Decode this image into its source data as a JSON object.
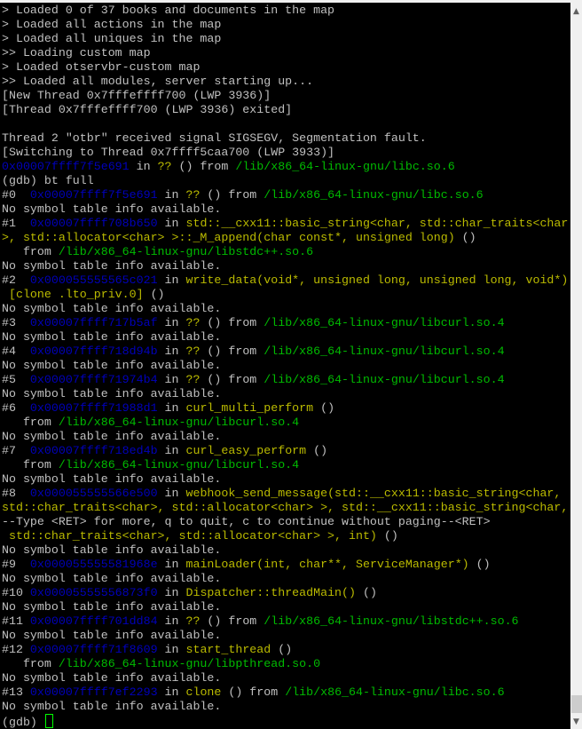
{
  "colors": {
    "default": "#c0c0c0",
    "address": "#0000bb",
    "function": "#bbbb00",
    "path": "#00bb00",
    "cursor": "#00ff00"
  },
  "lines": [
    [
      [
        "d",
        "> Loaded 0 of 37 books and documents in the map"
      ]
    ],
    [
      [
        "d",
        "> Loaded all actions in the map"
      ]
    ],
    [
      [
        "d",
        "> Loaded all uniques in the map"
      ]
    ],
    [
      [
        "d",
        ">> Loading custom map"
      ]
    ],
    [
      [
        "d",
        "> Loaded otservbr-custom map"
      ]
    ],
    [
      [
        "d",
        ">> Loaded all modules, server starting up..."
      ]
    ],
    [
      [
        "d",
        "[New Thread 0x7fffeffff700 (LWP 3936)]"
      ]
    ],
    [
      [
        "d",
        "[Thread 0x7fffeffff700 (LWP 3936) exited]"
      ]
    ],
    [],
    [
      [
        "d",
        "Thread 2 \"otbr\" received signal SIGSEGV, Segmentation fault."
      ]
    ],
    [
      [
        "d",
        "[Switching to Thread 0x7ffff5caa700 (LWP 3933)]"
      ]
    ],
    [
      [
        "a",
        "0x00007ffff7f5e691"
      ],
      [
        "d",
        " in "
      ],
      [
        "f",
        "??"
      ],
      [
        "d",
        " () from "
      ],
      [
        "p",
        "/lib/x86_64-linux-gnu/libc.so.6"
      ]
    ],
    [
      [
        "d",
        "(gdb) bt full"
      ]
    ],
    [
      [
        "d",
        "#0  "
      ],
      [
        "a",
        "0x00007ffff7f5e691"
      ],
      [
        "d",
        " in "
      ],
      [
        "f",
        "??"
      ],
      [
        "d",
        " () from "
      ],
      [
        "p",
        "/lib/x86_64-linux-gnu/libc.so.6"
      ]
    ],
    [
      [
        "d",
        "No symbol table info available."
      ]
    ],
    [
      [
        "d",
        "#1  "
      ],
      [
        "a",
        "0x00007ffff708b650"
      ],
      [
        "d",
        " in "
      ],
      [
        "f",
        "std::__cxx11::basic_string<char, std::char_traits<char"
      ]
    ],
    [
      [
        "f",
        ">, std::allocator<char> >::_M_append(char const*, unsigned long)"
      ],
      [
        "d",
        " ()"
      ]
    ],
    [
      [
        "d",
        "   from "
      ],
      [
        "p",
        "/lib/x86_64-linux-gnu/libstdc++.so.6"
      ]
    ],
    [
      [
        "d",
        "No symbol table info available."
      ]
    ],
    [
      [
        "d",
        "#2  "
      ],
      [
        "a",
        "0x000055555565c021"
      ],
      [
        "d",
        " in "
      ],
      [
        "f",
        "write_data(void*, unsigned long, unsigned long, void*)"
      ]
    ],
    [
      [
        "f",
        " [clone .lto_priv.0]"
      ],
      [
        "d",
        " ()"
      ]
    ],
    [
      [
        "d",
        "No symbol table info available."
      ]
    ],
    [
      [
        "d",
        "#3  "
      ],
      [
        "a",
        "0x00007ffff717b5af"
      ],
      [
        "d",
        " in "
      ],
      [
        "f",
        "??"
      ],
      [
        "d",
        " () from "
      ],
      [
        "p",
        "/lib/x86_64-linux-gnu/libcurl.so.4"
      ]
    ],
    [
      [
        "d",
        "No symbol table info available."
      ]
    ],
    [
      [
        "d",
        "#4  "
      ],
      [
        "a",
        "0x00007ffff718d94b"
      ],
      [
        "d",
        " in "
      ],
      [
        "f",
        "??"
      ],
      [
        "d",
        " () from "
      ],
      [
        "p",
        "/lib/x86_64-linux-gnu/libcurl.so.4"
      ]
    ],
    [
      [
        "d",
        "No symbol table info available."
      ]
    ],
    [
      [
        "d",
        "#5  "
      ],
      [
        "a",
        "0x00007ffff71974b4"
      ],
      [
        "d",
        " in "
      ],
      [
        "f",
        "??"
      ],
      [
        "d",
        " () from "
      ],
      [
        "p",
        "/lib/x86_64-linux-gnu/libcurl.so.4"
      ]
    ],
    [
      [
        "d",
        "No symbol table info available."
      ]
    ],
    [
      [
        "d",
        "#6  "
      ],
      [
        "a",
        "0x00007ffff71988d1"
      ],
      [
        "d",
        " in "
      ],
      [
        "f",
        "curl_multi_perform"
      ],
      [
        "d",
        " ()"
      ]
    ],
    [
      [
        "d",
        "   from "
      ],
      [
        "p",
        "/lib/x86_64-linux-gnu/libcurl.so.4"
      ]
    ],
    [
      [
        "d",
        "No symbol table info available."
      ]
    ],
    [
      [
        "d",
        "#7  "
      ],
      [
        "a",
        "0x00007ffff718ed4b"
      ],
      [
        "d",
        " in "
      ],
      [
        "f",
        "curl_easy_perform"
      ],
      [
        "d",
        " ()"
      ]
    ],
    [
      [
        "d",
        "   from "
      ],
      [
        "p",
        "/lib/x86_64-linux-gnu/libcurl.so.4"
      ]
    ],
    [
      [
        "d",
        "No symbol table info available."
      ]
    ],
    [
      [
        "d",
        "#8  "
      ],
      [
        "a",
        "0x000055555566e500"
      ],
      [
        "d",
        " in "
      ],
      [
        "f",
        "webhook_send_message(std::__cxx11::basic_string<char,"
      ]
    ],
    [
      [
        "f",
        "std::char_traits<char>, std::allocator<char> >, std::__cxx11::basic_string<char,"
      ]
    ],
    [
      [
        "d",
        "--Type <RET> for more, q to quit, c to continue without paging--<RET>"
      ]
    ],
    [
      [
        "f",
        " std::char_traits<char>, std::allocator<char> >, int)"
      ],
      [
        "d",
        " ()"
      ]
    ],
    [
      [
        "d",
        "No symbol table info available."
      ]
    ],
    [
      [
        "d",
        "#9  "
      ],
      [
        "a",
        "0x000055555581968e"
      ],
      [
        "d",
        " in "
      ],
      [
        "f",
        "mainLoader(int, char**, ServiceManager*)"
      ],
      [
        "d",
        " ()"
      ]
    ],
    [
      [
        "d",
        "No symbol table info available."
      ]
    ],
    [
      [
        "d",
        "#10 "
      ],
      [
        "a",
        "0x00005555556873f0"
      ],
      [
        "d",
        " in "
      ],
      [
        "f",
        "Dispatcher::threadMain()"
      ],
      [
        "d",
        " ()"
      ]
    ],
    [
      [
        "d",
        "No symbol table info available."
      ]
    ],
    [
      [
        "d",
        "#11 "
      ],
      [
        "a",
        "0x00007ffff701dd84"
      ],
      [
        "d",
        " in "
      ],
      [
        "f",
        "??"
      ],
      [
        "d",
        " () from "
      ],
      [
        "p",
        "/lib/x86_64-linux-gnu/libstdc++.so.6"
      ]
    ],
    [
      [
        "d",
        "No symbol table info available."
      ]
    ],
    [
      [
        "d",
        "#12 "
      ],
      [
        "a",
        "0x00007ffff71f8609"
      ],
      [
        "d",
        " in "
      ],
      [
        "f",
        "start_thread"
      ],
      [
        "d",
        " ()"
      ]
    ],
    [
      [
        "d",
        "   from "
      ],
      [
        "p",
        "/lib/x86_64-linux-gnu/libpthread.so.0"
      ]
    ],
    [
      [
        "d",
        "No symbol table info available."
      ]
    ],
    [
      [
        "d",
        "#13 "
      ],
      [
        "a",
        "0x00007ffff7ef2293"
      ],
      [
        "d",
        " in "
      ],
      [
        "f",
        "clone"
      ],
      [
        "d",
        " () from "
      ],
      [
        "p",
        "/lib/x86_64-linux-gnu/libc.so.6"
      ]
    ],
    [
      [
        "d",
        "No symbol table info available."
      ]
    ]
  ],
  "prompt": "(gdb) ",
  "scrollbar": {
    "up_icon": "▲",
    "down_icon": "▼",
    "position_fraction": 0.98
  }
}
